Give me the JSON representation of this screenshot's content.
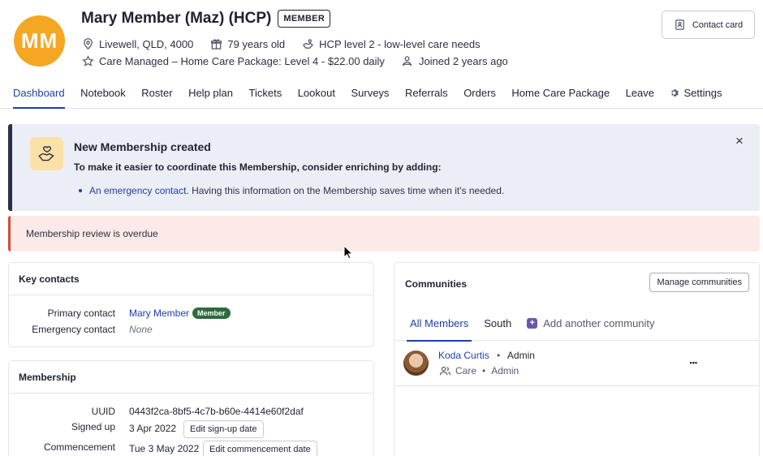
{
  "profile": {
    "initials": "MM",
    "name": "Mary Member (Maz) (HCP)",
    "badge": "MEMBER",
    "location": "Livewell, QLD, 4000",
    "age": "79 years old",
    "care_level": "HCP level 2 - low-level care needs",
    "package": "Care Managed – Home Care Package: Level 4 - $22.00 daily",
    "joined": "Joined 2 years ago",
    "avatar_color": "#f5a623"
  },
  "contact_card_label": "Contact card",
  "tabs": [
    {
      "label": "Dashboard",
      "active": true
    },
    {
      "label": "Notebook"
    },
    {
      "label": "Roster"
    },
    {
      "label": "Help plan"
    },
    {
      "label": "Tickets"
    },
    {
      "label": "Lookout"
    },
    {
      "label": "Surveys"
    },
    {
      "label": "Referrals"
    },
    {
      "label": "Orders"
    },
    {
      "label": "Home Care Package"
    },
    {
      "label": "Leave"
    },
    {
      "label": "Settings",
      "icon": "gear-icon"
    }
  ],
  "banner": {
    "title": "New Membership created",
    "subtitle": "To make it easier to coordinate this Membership, consider enriching by adding:",
    "item_link": "An emergency contact",
    "item_text": ". Having this information on the Membership saves time when it's needed.",
    "close": "×"
  },
  "alert": {
    "text": "Membership review is overdue",
    "color": "#d64a3a"
  },
  "key_contacts": {
    "title": "Key contacts",
    "primary_label": "Primary contact",
    "primary_value": "Mary Member",
    "primary_badge": "Member",
    "emergency_label": "Emergency contact",
    "emergency_value": "None"
  },
  "membership": {
    "title": "Membership",
    "uuid_label": "UUID",
    "uuid_value": "0443f2ca-8bf5-4c7b-b60e-4414e60f2daf",
    "signup_label": "Signed up",
    "signup_value": "3 Apr 2022",
    "signup_button": "Edit sign-up date",
    "commence_label": "Commencement",
    "commence_value": "Tue 3 May 2022",
    "commence_button": "Edit commencement date"
  },
  "communities": {
    "title": "Communities",
    "manage_button": "Manage communities",
    "tabs": [
      "All Members",
      "South"
    ],
    "add_label": "Add another community",
    "member": {
      "name": "Koda Curtis",
      "role": "Admin",
      "group": "Care",
      "group_role": "Admin",
      "more": "•••"
    }
  },
  "bullet": "•"
}
